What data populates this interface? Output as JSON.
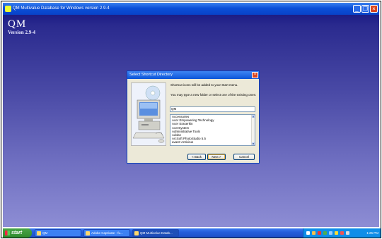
{
  "app": {
    "title": "QM Multivalue Database for Windows version 2.9-4",
    "name": "QM",
    "version": "Version 2.9-4"
  },
  "dialog": {
    "title": "Select Shortcut Directory",
    "message1": "Shortcut icons will be added to your Start menu.",
    "message2": "You may type a new folder or select one of the existing ones:",
    "folder_value": "QM",
    "folders": [
      "Accessories",
      "Acer Empowering Technology",
      "Acer Eraserkin",
      "AcerSystem",
      "Administrative Tools",
      "Adobe",
      "ArcSoft PhotoStudio 5.5",
      "avast! Antivirus"
    ],
    "back_label": "< Back",
    "next_label": "Next >",
    "cancel_label": "Cancel"
  },
  "taskbar": {
    "start_label": "start",
    "tasks": [
      "QM",
      "Adobe Captivate - fu...",
      "QM Multivalue Datab..."
    ],
    "clock": "1:25 PM"
  },
  "colors": {
    "titlebar": "#0a4fd8",
    "desktop_top": "#0c0c7a",
    "desktop_bottom": "#8d8dd4",
    "dialog_bg": "#ece9d8"
  }
}
